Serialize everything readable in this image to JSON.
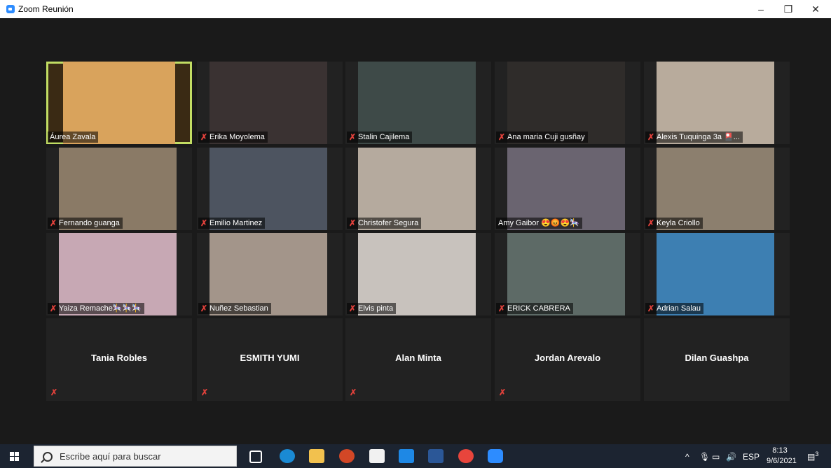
{
  "window": {
    "title": "Zoom Reunión",
    "minimize": "–",
    "restore": "❐",
    "close": "✕"
  },
  "video_tiles": [
    {
      "name": "Áurea Zavala",
      "muted": false,
      "active": true,
      "bg": "#3a2a14",
      "video": "#d9a35c"
    },
    {
      "name": "Erika Moyolema",
      "muted": true,
      "active": false,
      "bg": "#222222",
      "video": "#3a3232"
    },
    {
      "name": "Stalin Cajilema",
      "muted": true,
      "active": false,
      "bg": "#222222",
      "video": "#3e4a48"
    },
    {
      "name": "Ana maria Cuji gusñay",
      "muted": true,
      "active": false,
      "bg": "#222222",
      "video": "#2f2c2a"
    },
    {
      "name": "Alexis Tuquinga 3a 🎴...",
      "muted": true,
      "active": false,
      "bg": "#222222",
      "video": "#b8ab9c"
    },
    {
      "name": "Fernando guanga",
      "muted": true,
      "active": false,
      "bg": "#222222",
      "video": "#8a7a66"
    },
    {
      "name": "Emilio Martinez",
      "muted": true,
      "active": false,
      "bg": "#222222",
      "video": "#4d5460"
    },
    {
      "name": "Christofer Segura",
      "muted": true,
      "active": false,
      "bg": "#222222",
      "video": "#b5aa9e"
    },
    {
      "name": "Amy  Gaibor 😍😡😍🎠",
      "muted": false,
      "active": false,
      "bg": "#222222",
      "video": "#6a6470"
    },
    {
      "name": "Keyla  Criollo",
      "muted": true,
      "active": false,
      "bg": "#222222",
      "video": "#8c7f6e"
    },
    {
      "name": "Yaiza Remache🎠🎠🎠",
      "muted": true,
      "active": false,
      "bg": "#222222",
      "video": "#c7a8b4"
    },
    {
      "name": "Nuñez Sebastian",
      "muted": true,
      "active": false,
      "bg": "#222222",
      "video": "#a3958a"
    },
    {
      "name": "Elvis pinta",
      "muted": true,
      "active": false,
      "bg": "#222222",
      "video": "#c8c2bd"
    },
    {
      "name": "ERICK CABRERA",
      "muted": true,
      "active": false,
      "bg": "#222222",
      "video": "#5d6a66"
    },
    {
      "name": "Adrian Salau",
      "muted": true,
      "active": false,
      "bg": "#222222",
      "video": "#3d7fb2"
    }
  ],
  "name_tiles": [
    {
      "name": "Tania Robles",
      "muted": true
    },
    {
      "name": "ESMITH YUMI",
      "muted": true
    },
    {
      "name": "Alan  Minta",
      "muted": true
    },
    {
      "name": "Jordan Arevalo",
      "muted": true
    },
    {
      "name": "Dilan Guashpa",
      "muted": false
    }
  ],
  "taskbar": {
    "search_placeholder": "Escribe aquí para buscar",
    "language": "ESP",
    "time": "8:13",
    "date": "9/6/2021",
    "notifications": "3"
  },
  "colors": {
    "active_speaker_border": "#c2dd63",
    "muted_icon": "#e0413b",
    "zoom_blue": "#2d8cff"
  }
}
